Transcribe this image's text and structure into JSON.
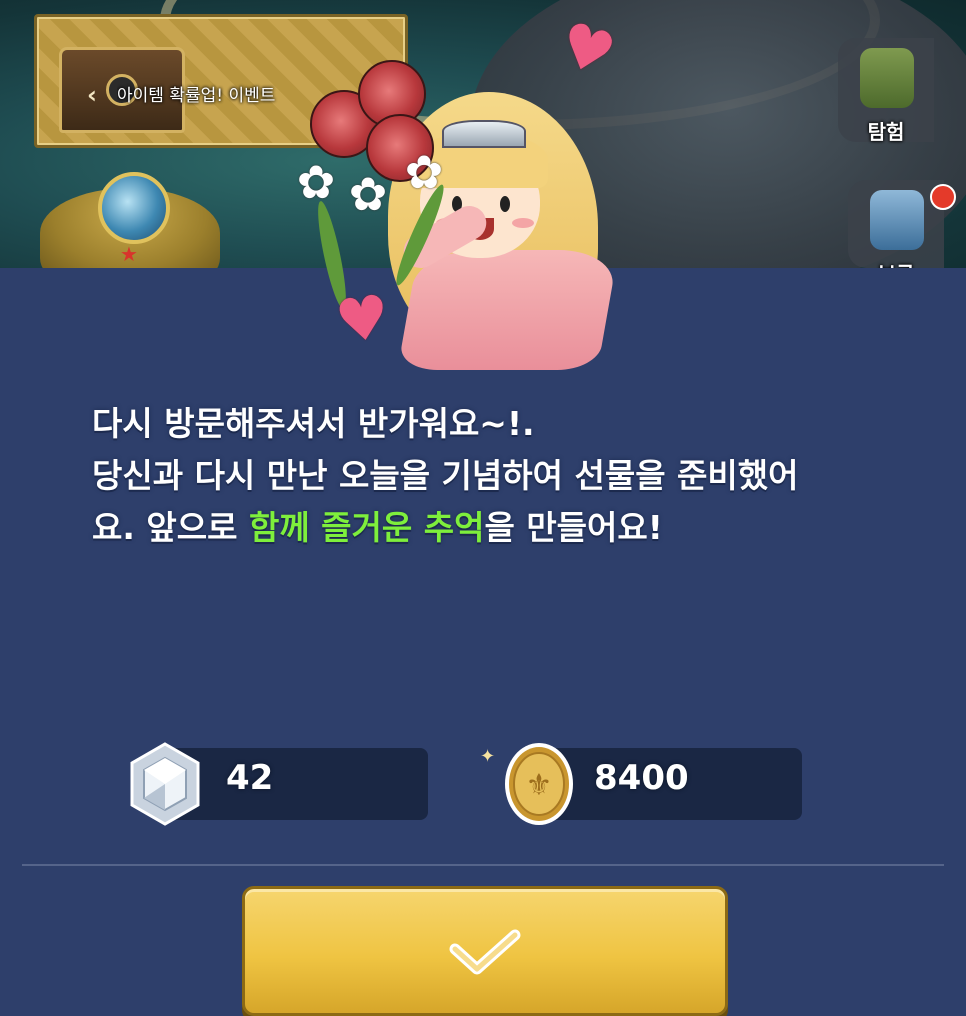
{
  "scene": {
    "event_banner_label": "아이템 확률업! 이벤트",
    "side_buttons": [
      {
        "label": "탐험"
      },
      {
        "label": "보급"
      }
    ]
  },
  "dialog": {
    "message_line1": "다시 방문해주셔서 반가워요~!.",
    "message_line2": "당신과 다시 만난 오늘을 기념하여 선물을 준비했어",
    "message_line3_prefix": "요. 앞으로 ",
    "message_line3_highlight": "함께 즐거운 추억",
    "message_line3_suffix": "을 만들어요!",
    "highlight_color": "#7eef3c",
    "rewards": [
      {
        "icon": "diamond-icon",
        "value": "42"
      },
      {
        "icon": "gold-coin-icon",
        "value": "8400"
      }
    ],
    "confirm_icon": "checkmark-icon",
    "button_color": "#efc442",
    "panel_color": "#2e3f6b"
  }
}
